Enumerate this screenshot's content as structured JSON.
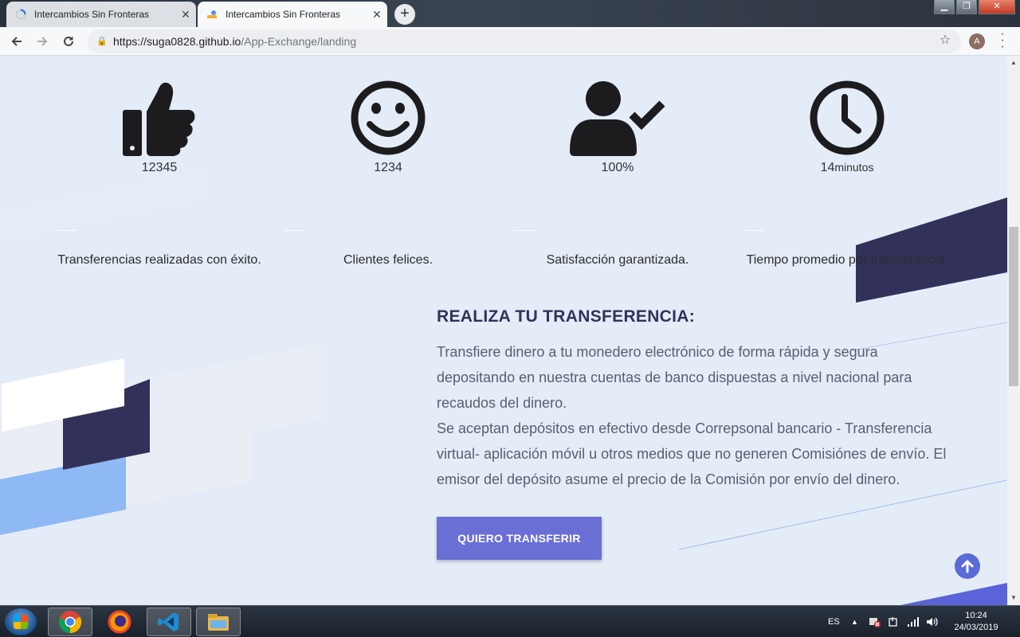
{
  "browser": {
    "tabs": [
      {
        "title": "Intercambios Sin Fronteras",
        "active": false,
        "loading": true
      },
      {
        "title": "Intercambios Sin Fronteras",
        "active": true,
        "loading": false
      }
    ],
    "url_host": "https://suga0828.github.io",
    "url_path": "/App-Exchange/landing",
    "profile_initial": "A"
  },
  "stats": [
    {
      "icon": "thumbs-up-icon",
      "value": "12345",
      "unit": "",
      "description": "Transferencias realizadas con éxito."
    },
    {
      "icon": "smile-icon",
      "value": "1234",
      "unit": "",
      "description": "Clientes felices."
    },
    {
      "icon": "user-check-icon",
      "value": "100%",
      "unit": "",
      "description": "Satisfacción garantizada."
    },
    {
      "icon": "clock-icon",
      "value": "14",
      "unit": "minutos",
      "description": "Tiempo promedio por transferencia."
    }
  ],
  "cta": {
    "title": "REALIZA TU TRANSFERENCIA:",
    "paragraph1": "Transfiere dinero a tu monedero electrónico de forma rápida y segura depositando en nuestra cuentas de banco dispuestas a nivel nacional para recaudos del dinero.",
    "paragraph2": "Se aceptan depósitos en efectivo desde Correpsonal bancario - Transferencia virtual- aplicación móvil u otros medios que no generen Comisiónes de envío. El emisor del depósito asume el precio de la Comisión por envío del dinero.",
    "button": "QUIERO TRANSFERIR"
  },
  "colors": {
    "page_bg": "#e4ecf8",
    "accent": "#6a6fd6",
    "dark_navy": "#323159",
    "light_blue": "#8fb9f5"
  },
  "taskbar": {
    "language": "ES",
    "time": "10:24",
    "date": "24/03/2019",
    "apps": [
      "chrome-icon",
      "firefox-icon",
      "vscode-icon",
      "file-explorer-icon"
    ]
  }
}
